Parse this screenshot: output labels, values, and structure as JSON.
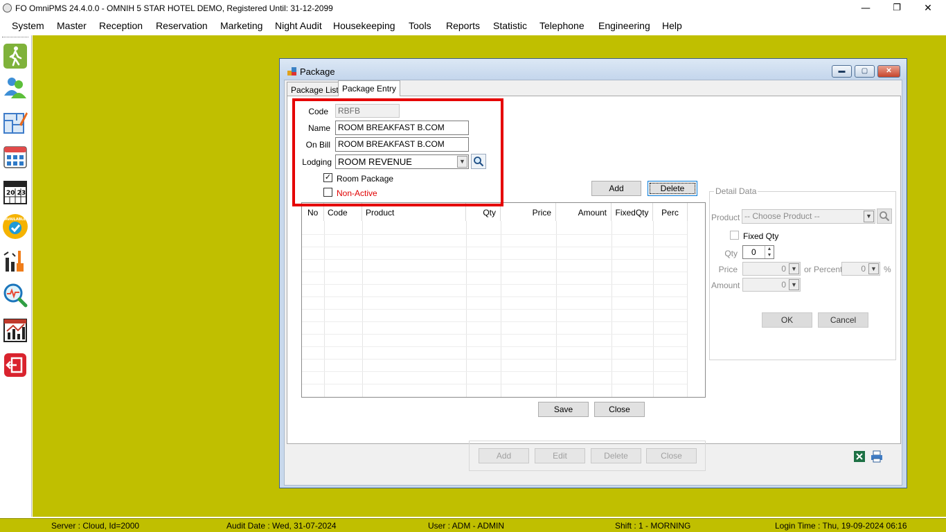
{
  "window": {
    "title": "FO OmniPMS 24.4.0.0 - OMNIH 5 STAR HOTEL DEMO, Registered Until: 31-12-2099",
    "controls": {
      "minimize": "—",
      "restore": "❐",
      "close": "✕"
    }
  },
  "menu": [
    "System",
    "Master",
    "Reception",
    "Reservation",
    "Marketing",
    "Night Audit",
    "Housekeeping",
    "Tools",
    "Reports",
    "Statistic",
    "Telephone",
    "Engineering",
    "Help"
  ],
  "sidebar": {
    "icons": [
      "walk-in-icon",
      "guests-icon",
      "floor-plan-icon",
      "room-availability-icon",
      "calendar-icon",
      "available-badge-icon",
      "housekeeping-icon",
      "search-analysis-icon",
      "statistics-chart-icon",
      "exit-icon"
    ],
    "calendar_text": "20 23",
    "badge_text": "AVAILABLE"
  },
  "package_window": {
    "title": "Package",
    "tabs": [
      {
        "label": "Package List"
      },
      {
        "label": "Package Entry"
      }
    ],
    "form": {
      "code_label": "Code",
      "code_value": "RBFB",
      "name_label": "Name",
      "name_value": "ROOM BREAKFAST B.COM",
      "onbill_label": "On Bill",
      "onbill_value": "ROOM BREAKFAST B.COM",
      "lodging_label": "Lodging",
      "lodging_value": "ROOM REVENUE",
      "room_package_label": "Room Package",
      "room_package_checked": true,
      "non_active_label": "Non-Active",
      "non_active_checked": false,
      "non_active_color": "#e00000"
    },
    "grid_buttons": {
      "add": "Add",
      "delete": "Delete"
    },
    "grid": {
      "columns": [
        "No",
        "Code",
        "Product",
        "Qty",
        "Price",
        "Amount",
        "FixedQty",
        "Perc"
      ]
    },
    "detail": {
      "title": "Detail Data",
      "product_label": "Product",
      "product_placeholder": "-- Choose Product --",
      "fixed_qty_label": "Fixed Qty",
      "qty_label": "Qty",
      "qty_value": "0",
      "price_label": "Price",
      "price_value": "0",
      "or_percent_label": "or Percent",
      "percent_value": "0",
      "percent_suffix": "%",
      "amount_label": "Amount",
      "amount_value": "0",
      "ok": "OK",
      "cancel": "Cancel"
    },
    "actions": {
      "save": "Save",
      "close": "Close"
    },
    "bottom_actions": {
      "add": "Add",
      "edit": "Edit",
      "delete": "Delete",
      "close": "Close"
    }
  },
  "status": {
    "server": "Server : Cloud, Id=2000",
    "audit_date": "Audit Date : Wed, 31-07-2024",
    "user": "User : ADM - ADMIN",
    "shift": "Shift : 1 - MORNING",
    "login_time": "Login Time : Thu, 19-09-2024 06:16"
  },
  "colors": {
    "desktop": "#c0bf00",
    "highlight": "#e50000"
  }
}
